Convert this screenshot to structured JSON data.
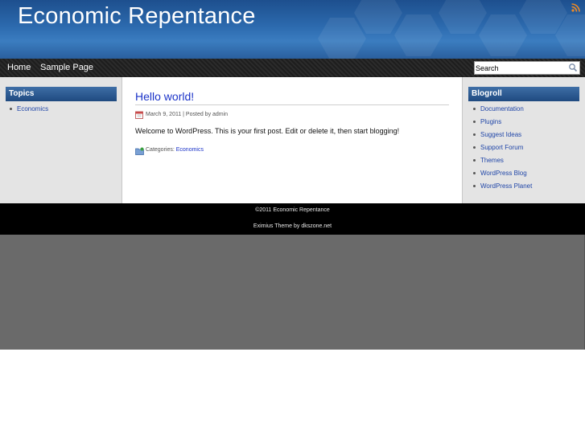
{
  "header": {
    "site_title": "Economic Repentance"
  },
  "nav": {
    "items": [
      {
        "label": "Home"
      },
      {
        "label": "Sample Page"
      }
    ],
    "search": {
      "value": "Search"
    }
  },
  "left_sidebar": {
    "title": "Topics",
    "items": [
      {
        "label": "Economics"
      }
    ]
  },
  "post": {
    "title": "Hello world!",
    "meta": "March 9, 2011 | Posted by admin",
    "body": "Welcome to WordPress. This is your first post. Edit or delete it, then start blogging!",
    "categories_label": "Categories:",
    "category": "Economics"
  },
  "right_sidebar": {
    "title": "Blogroll",
    "items": [
      {
        "label": "Documentation"
      },
      {
        "label": "Plugins"
      },
      {
        "label": "Suggest Ideas"
      },
      {
        "label": "Support Forum"
      },
      {
        "label": "Themes"
      },
      {
        "label": "WordPress Blog"
      },
      {
        "label": "WordPress Planet"
      }
    ]
  },
  "footer": {
    "copyright": "©2011 Economic Repentance",
    "credit": "Eximius Theme by dkszone.net"
  },
  "colors": {
    "header_blue": "#2c6aae",
    "link_blue": "#1b33c8",
    "widget_title_blue": "#1f4a80",
    "rss_orange": "#f08a24"
  }
}
